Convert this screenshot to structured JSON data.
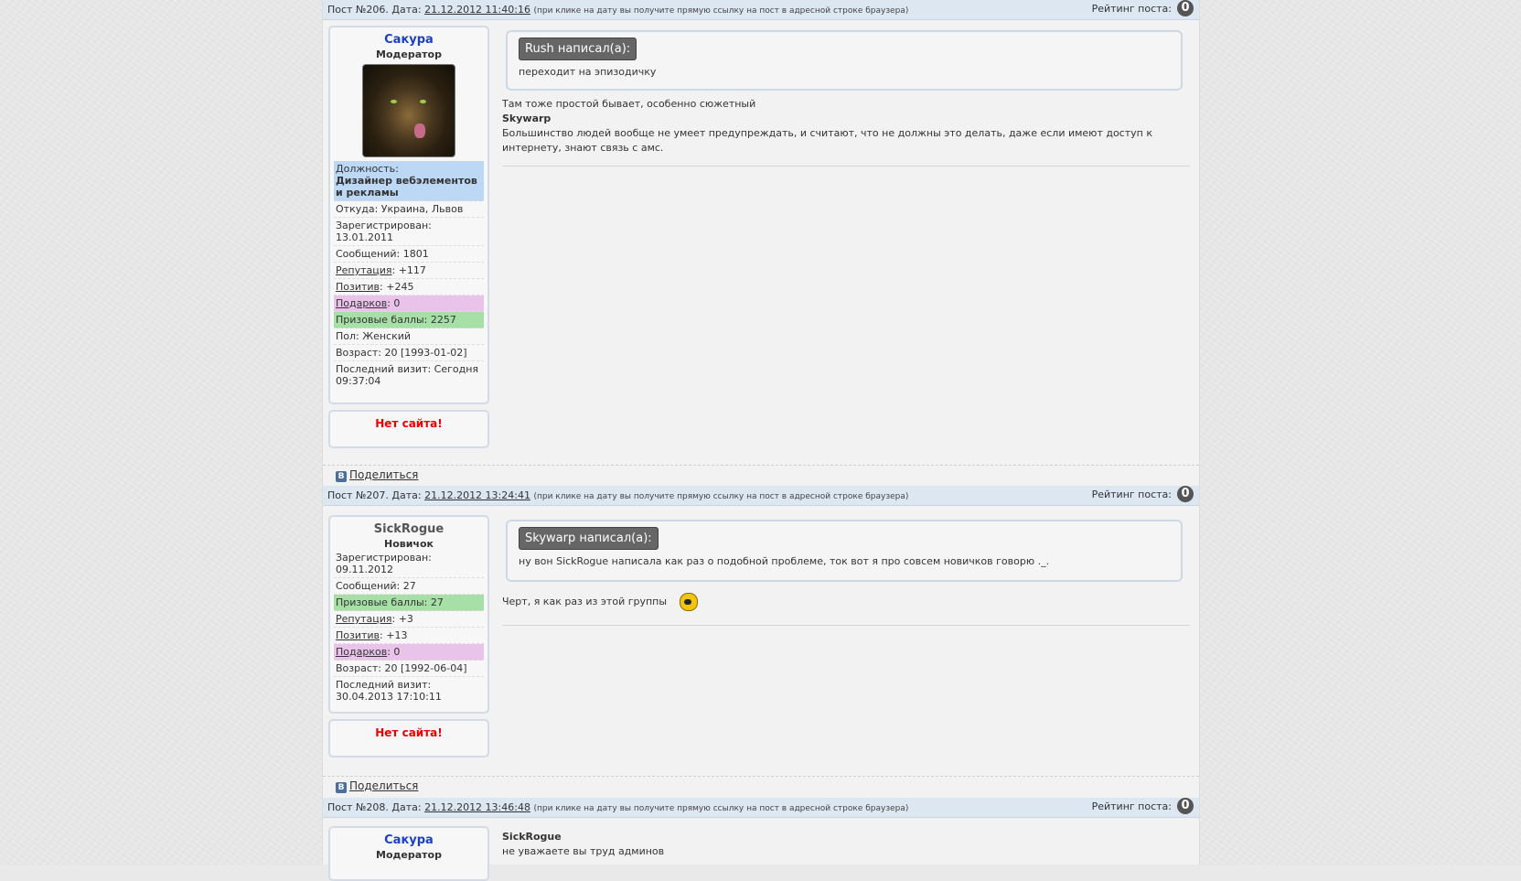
{
  "posts": [
    {
      "number_label": "Пост №206. Дата:",
      "date": "21.12.2012 11:40:16",
      "date_hint": "(при клике на дату вы получите прямую ссылку на пост в адресной строке браузера)",
      "rating_label": "Рейтинг поста:",
      "rating_value": "0",
      "author": {
        "name": "Сакура",
        "rank": "Модератор",
        "position_label": "Должность:",
        "position_value": "Дизайнер вебэлементов и рекламы",
        "from": "Откуда: Украина, Львов",
        "registered": "Зарегистрирован: 13.01.2011",
        "messages": "Сообщений: 1801",
        "reputation_link": "Репутация",
        "reputation_value": ": +117",
        "positive_link": "Позитив",
        "positive_value": ": +245",
        "gifts_link": "Подарков",
        "gifts_value": ": 0",
        "prize": "Призовые баллы: 2257",
        "gender": "Пол: Женский",
        "age": "Возраст: 20 [1993-01-02]",
        "last_visit": "Последний визит: Сегодня 09:37:04"
      },
      "no_site": "Нет сайта!",
      "share": "Поделиться",
      "quote_head": "Rush написал(а):",
      "quote_text": "переходит на эпизодичку",
      "body_line1": "Там тоже простой бывает, особенно сюжетный",
      "body_bold": "Skywarp",
      "body_line2": "Большинство людей вообще не умеет предупреждать, и считают, что не должны это делать, даже если имеют доступ к интернету, знают связь с амс."
    },
    {
      "number_label": "Пост №207. Дата:",
      "date": "21.12.2012 13:24:41",
      "date_hint": "(при клике на дату вы получите прямую ссылку на пост в адресной строке браузера)",
      "rating_label": "Рейтинг поста:",
      "rating_value": "0",
      "author": {
        "name": "SickRogue",
        "rank": "Новичок",
        "registered": "Зарегистрирован: 09.11.2012",
        "messages": "Сообщений: 27",
        "prize": "Призовые баллы: 27",
        "reputation_link": "Репутация",
        "reputation_value": ": +3",
        "positive_link": "Позитив",
        "positive_value": ": +13",
        "gifts_link": "Подарков",
        "gifts_value": ": 0",
        "age": "Возраст: 20 [1992-06-04]",
        "last_visit": "Последний визит: 30.04.2013 17:10:11"
      },
      "no_site": "Нет сайта!",
      "share": "Поделиться",
      "quote_head": "Skywarp написал(а):",
      "quote_text": "ну вон SickRogue написала как раз о подобной проблеме, ток вот я про совсем новичков говорю ._.",
      "body_line1": "Черт, я как раз из этой группы"
    },
    {
      "number_label": "Пост №208. Дата:",
      "date": "21.12.2012 13:46:48",
      "date_hint": "(при клике на дату вы получите прямую ссылку на пост в адресной строке браузера)",
      "rating_label": "Рейтинг поста:",
      "rating_value": "0",
      "author": {
        "name": "Сакура",
        "rank": "Модератор"
      },
      "body_bold": "SickRogue",
      "body_line1": "не уважаете вы труд админов"
    }
  ]
}
